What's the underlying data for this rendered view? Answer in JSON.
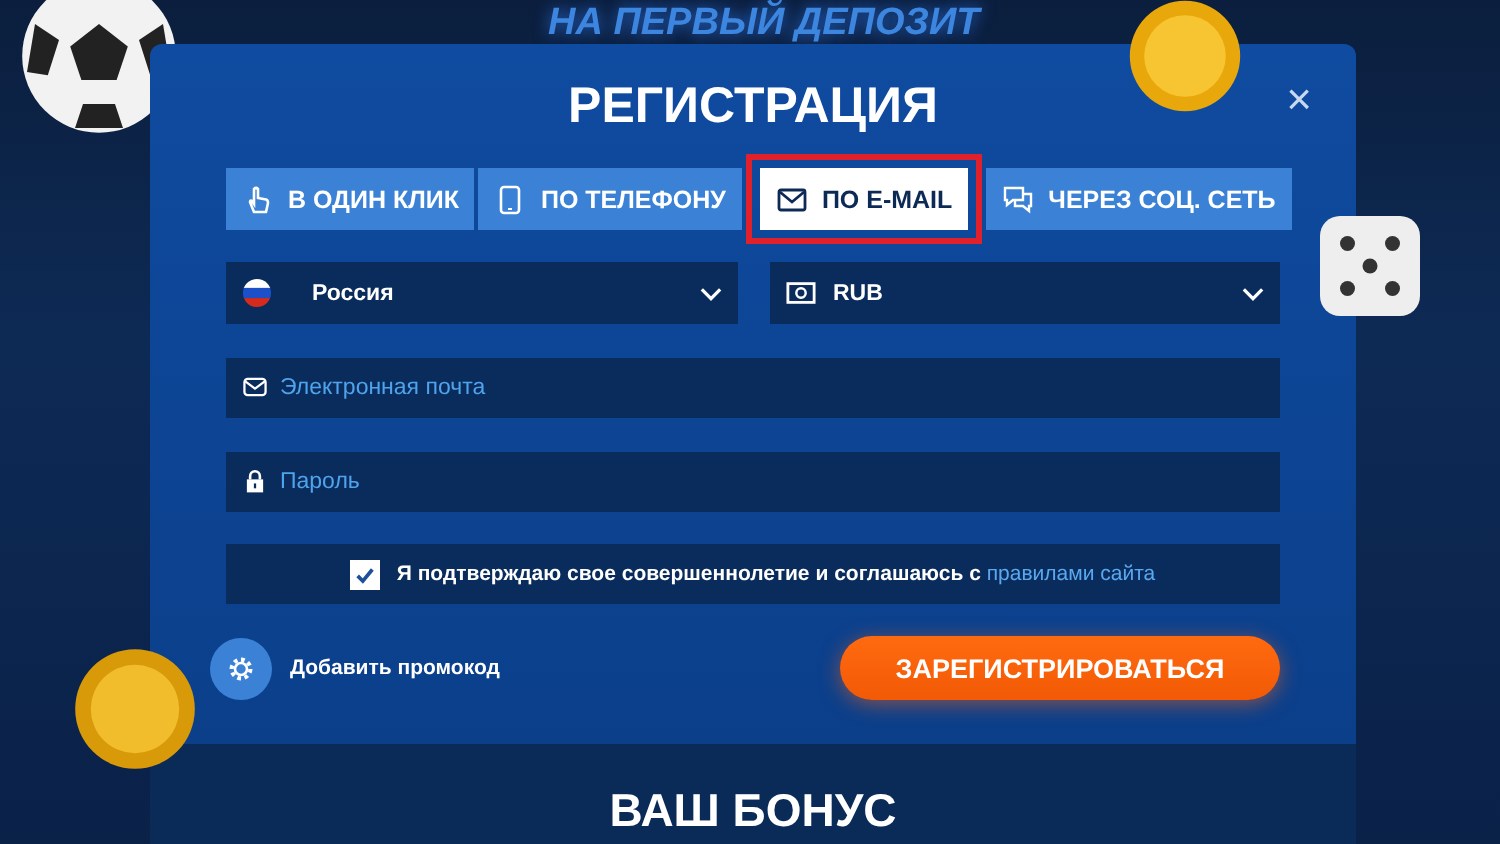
{
  "background": {
    "headline": "НА ПЕРВЫЙ ДЕПОЗИТ"
  },
  "modal": {
    "title": "РЕГИСТРАЦИЯ",
    "close": "×",
    "tabs": [
      {
        "label": "В ОДИН КЛИК",
        "kind": "click",
        "selected": false,
        "highlighted": false
      },
      {
        "label": "ПО ТЕЛЕФОНУ",
        "kind": "phone",
        "selected": false,
        "highlighted": false
      },
      {
        "label": "ПО E-MAIL",
        "kind": "email",
        "selected": true,
        "highlighted": true
      },
      {
        "label": "ЧЕРЕЗ СОЦ. СЕТЬ",
        "kind": "social",
        "selected": false,
        "highlighted": false
      }
    ],
    "selects": [
      {
        "kind": "country",
        "value": "Россия"
      },
      {
        "kind": "currency",
        "value": "RUB"
      }
    ],
    "fields": [
      {
        "kind": "email",
        "placeholder": "Электронная почта"
      },
      {
        "kind": "password",
        "placeholder": "Пароль"
      }
    ],
    "agreement": {
      "checked": true,
      "text": "Я подтверждаю свое совершеннолетие и соглашаюсь с",
      "link": "правилами сайта"
    },
    "promo": {
      "label": "Добавить промокод"
    },
    "submit": "ЗАРЕГИСТРИРОВАТЬСЯ",
    "bonus_title": "ВАШ БОНУС"
  }
}
